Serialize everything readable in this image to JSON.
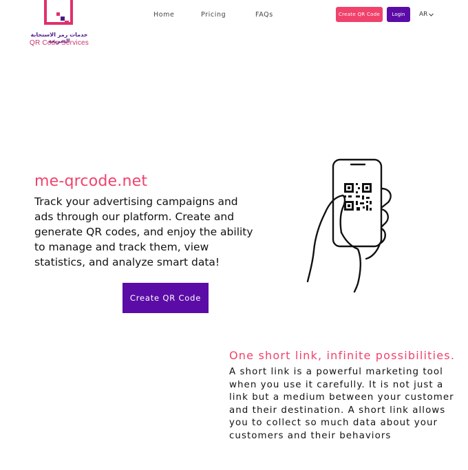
{
  "logo": {
    "arabic_text": "خدمات رمز الاستجابة السريعة",
    "english_text": "QR Code Services",
    "colors": {
      "pink": "#e0306a",
      "purple": "#4a1a8a"
    }
  },
  "nav": {
    "items": [
      {
        "label": "Home"
      },
      {
        "label": "Pricing"
      },
      {
        "label": "FAQs"
      }
    ],
    "create_button": "Create QR Code",
    "login_button": "Login",
    "language": "AR",
    "language_icon": "chevron-down-icon"
  },
  "hero": {
    "title": "me-qrcode.net",
    "description": "Track your advertising campaigns and ads through our platform. Create and generate QR codes, and enjoy the ability to manage and track them, view statistics, and analyze smart data!",
    "cta": "Create QR Code",
    "illustration": "hand-holding-phone-qr-icon"
  },
  "section": {
    "title": "One short link, infinite possibilities.",
    "description": "A short link is a powerful marketing tool when you use it carefully. It is not just a link but a medium between your customer and their destination. A short link allows you to collect so much data about your customers and their behaviors"
  },
  "colors": {
    "accent_pink": "#f0426b",
    "accent_purple": "#5b0ca6"
  }
}
